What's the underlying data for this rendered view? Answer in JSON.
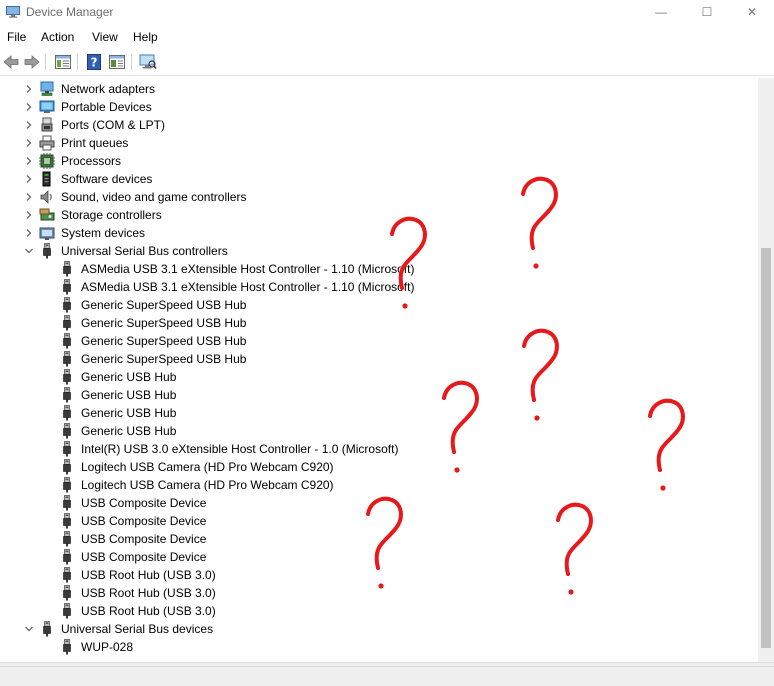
{
  "window": {
    "title": "Device Manager",
    "minimize_glyph": "—",
    "maximize_glyph": "☐",
    "close_glyph": "✕"
  },
  "menu": [
    "File",
    "Action",
    "View",
    "Help"
  ],
  "toolbar": [
    "back-arrow-icon",
    "forward-arrow-icon",
    "show-hide-console-tree-icon",
    "help-icon",
    "properties-icon",
    "scan-hardware-icon"
  ],
  "tree": [
    {
      "label": "Network adapters",
      "level": 0,
      "expanded": false,
      "icon": "network-adapter-icon"
    },
    {
      "label": "Portable Devices",
      "level": 0,
      "expanded": false,
      "icon": "portable-device-icon"
    },
    {
      "label": "Ports (COM & LPT)",
      "level": 0,
      "expanded": false,
      "icon": "port-icon"
    },
    {
      "label": "Print queues",
      "level": 0,
      "expanded": false,
      "icon": "printer-icon"
    },
    {
      "label": "Processors",
      "level": 0,
      "expanded": false,
      "icon": "processor-icon"
    },
    {
      "label": "Software devices",
      "level": 0,
      "expanded": false,
      "icon": "software-device-icon"
    },
    {
      "label": "Sound, video and game controllers",
      "level": 0,
      "expanded": false,
      "icon": "speaker-icon"
    },
    {
      "label": "Storage controllers",
      "level": 0,
      "expanded": false,
      "icon": "storage-controller-icon"
    },
    {
      "label": "System devices",
      "level": 0,
      "expanded": false,
      "icon": "system-device-icon"
    },
    {
      "label": "Universal Serial Bus controllers",
      "level": 0,
      "expanded": true,
      "icon": "usb-plug-icon"
    },
    {
      "label": "ASMedia USB 3.1 eXtensible Host Controller - 1.10 (Microsoft)",
      "level": 1,
      "icon": "usb-plug-icon"
    },
    {
      "label": "ASMedia USB 3.1 eXtensible Host Controller - 1.10 (Microsoft)",
      "level": 1,
      "icon": "usb-plug-icon"
    },
    {
      "label": "Generic SuperSpeed USB Hub",
      "level": 1,
      "icon": "usb-plug-icon"
    },
    {
      "label": "Generic SuperSpeed USB Hub",
      "level": 1,
      "icon": "usb-plug-icon"
    },
    {
      "label": "Generic SuperSpeed USB Hub",
      "level": 1,
      "icon": "usb-plug-icon"
    },
    {
      "label": "Generic SuperSpeed USB Hub",
      "level": 1,
      "icon": "usb-plug-icon"
    },
    {
      "label": "Generic USB Hub",
      "level": 1,
      "icon": "usb-plug-icon"
    },
    {
      "label": "Generic USB Hub",
      "level": 1,
      "icon": "usb-plug-icon"
    },
    {
      "label": "Generic USB Hub",
      "level": 1,
      "icon": "usb-plug-icon"
    },
    {
      "label": "Generic USB Hub",
      "level": 1,
      "icon": "usb-plug-icon"
    },
    {
      "label": "Intel(R) USB 3.0 eXtensible Host Controller - 1.0 (Microsoft)",
      "level": 1,
      "icon": "usb-plug-icon"
    },
    {
      "label": "Logitech USB Camera (HD Pro Webcam C920)",
      "level": 1,
      "icon": "usb-plug-icon"
    },
    {
      "label": "Logitech USB Camera (HD Pro Webcam C920)",
      "level": 1,
      "icon": "usb-plug-icon"
    },
    {
      "label": "USB Composite Device",
      "level": 1,
      "icon": "usb-plug-icon"
    },
    {
      "label": "USB Composite Device",
      "level": 1,
      "icon": "usb-plug-icon"
    },
    {
      "label": "USB Composite Device",
      "level": 1,
      "icon": "usb-plug-icon"
    },
    {
      "label": "USB Composite Device",
      "level": 1,
      "icon": "usb-plug-icon"
    },
    {
      "label": "USB Root Hub (USB 3.0)",
      "level": 1,
      "icon": "usb-plug-icon"
    },
    {
      "label": "USB Root Hub (USB 3.0)",
      "level": 1,
      "icon": "usb-plug-icon"
    },
    {
      "label": "USB Root Hub (USB 3.0)",
      "level": 1,
      "icon": "usb-plug-icon"
    },
    {
      "label": "Universal Serial Bus devices",
      "level": 0,
      "expanded": true,
      "icon": "usb-plug-icon"
    },
    {
      "label": "WUP-028",
      "level": 1,
      "icon": "usb-plug-icon"
    }
  ],
  "colors": {
    "annotation": "#e8191b",
    "text": "#000000",
    "title_text": "#6d6d6d",
    "chevron": "#595959"
  }
}
